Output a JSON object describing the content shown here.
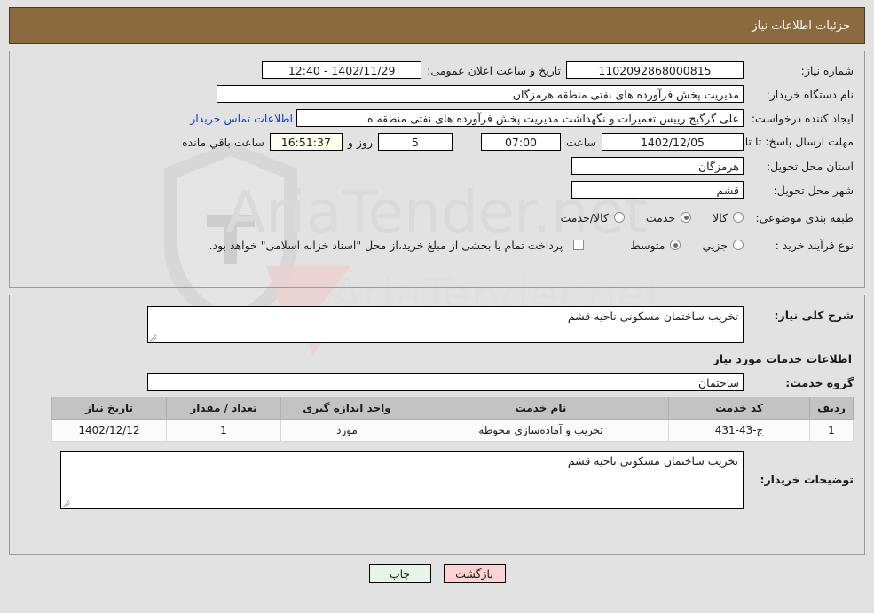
{
  "header": {
    "title": "جزئیات اطلاعات نیاز"
  },
  "info": {
    "need_number_label": "شماره نیاز:",
    "need_number": "1102092868000815",
    "announce_label": "تاریخ و ساعت اعلان عمومی:",
    "announce_value": "1402/11/29 - 12:40",
    "buyer_org_label": "نام دستگاه خریدار:",
    "buyer_org": "مدیریت پخش فرآورده های نفتی منطقه هرمزگان",
    "creator_label": "ایجاد کننده درخواست:",
    "creator": "علی گرگیج رییس تعمیرات و نگهداشت مدیریت پخش فرآورده های نفتی منطقه ه",
    "contact_link": "اطلاعات تماس خریدار",
    "deadline_label": "مهلت ارسال پاسخ: تا تاریخ:",
    "deadline_date": "1402/12/05",
    "hour_label": "ساعت",
    "deadline_time": "07:00",
    "days_remaining": "5",
    "days_label": "روز و",
    "countdown": "16:51:37",
    "remaining_label": "ساعت باقي مانده",
    "province_label": "استان محل تحویل:",
    "province": "هرمزگان",
    "city_label": "شهر محل تحویل:",
    "city": "قشم",
    "category_label": "طبقه بندی موضوعی:",
    "category_options": [
      "کالا",
      "خدمت",
      "کالا/خدمت"
    ],
    "category_selected": "خدمت",
    "process_label": "نوع فرآیند خرید :",
    "process_options": [
      "جزیي",
      "متوسط"
    ],
    "process_selected": "متوسط",
    "treasury_note": "پرداخت تمام یا بخشی از مبلغ خرید،از محل \"اسناد خزانه اسلامی\" خواهد بود.",
    "treasury_checked": false
  },
  "description": {
    "label": "شرح کلی نیاز:",
    "value": "تخریب ساختمان مسکونی ناحیه قشم"
  },
  "services": {
    "section_title": "اطلاعات خدمات مورد نیاز",
    "group_label": "گروه خدمت:",
    "group_value": "ساختمان",
    "columns": [
      "ردیف",
      "کد خدمت",
      "نام خدمت",
      "واحد اندازه گیری",
      "تعداد / مقدار",
      "تاریخ نیاز"
    ],
    "rows": [
      {
        "index": "1",
        "code": "ج-43-431",
        "name": "تخریب و آماده‌سازی محوطه",
        "unit": "مورد",
        "quantity": "1",
        "need_date": "1402/12/12"
      }
    ]
  },
  "buyer_notes": {
    "label": "توضیحات خریدار:",
    "value": "تخریب ساختمان مسکونی ناحیه قشم"
  },
  "footer": {
    "print_label": "چاپ",
    "back_label": "بازگشت"
  },
  "watermark": {
    "text": "AriaTender.net"
  }
}
